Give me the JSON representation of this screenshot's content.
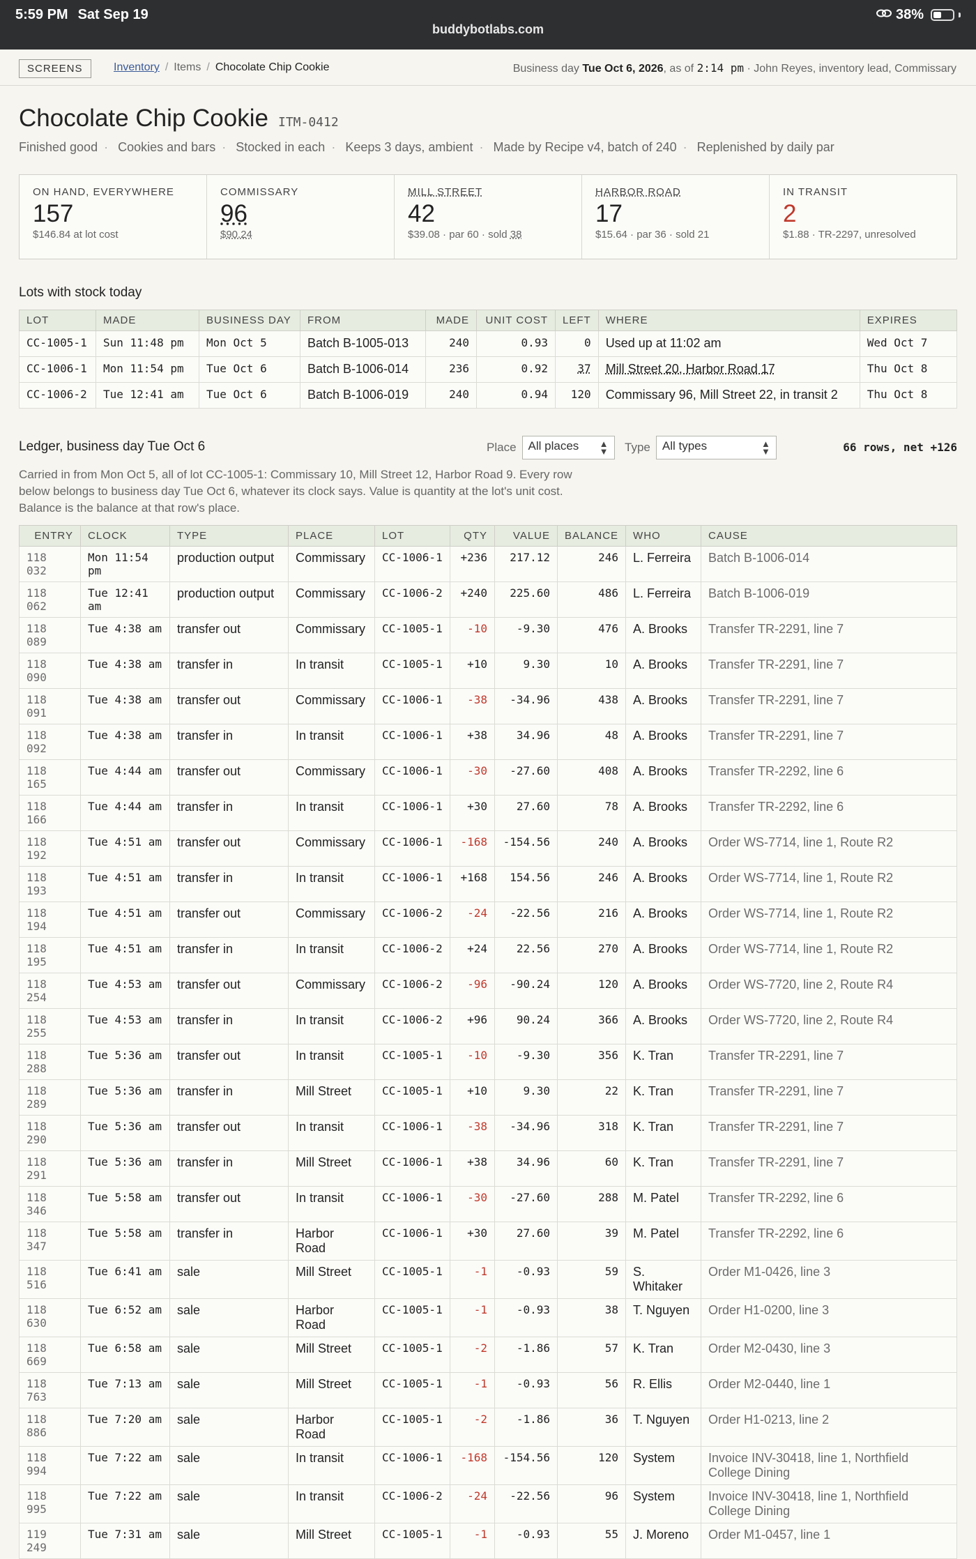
{
  "status_bar": {
    "time": "5:59 PM",
    "date": "Sat Sep 19",
    "url": "buddybotlabs.com",
    "battery": "38%",
    "link_icon": "link-icon"
  },
  "nav": {
    "screens_label": "SCREENS",
    "crumb_inventory": "Inventory",
    "crumb_items": "Items",
    "crumb_current": "Chocolate Chip Cookie",
    "biz_prefix": "Business day ",
    "biz_day": "Tue Oct 6, 2026",
    "biz_asof": ", as of ",
    "biz_time": "2:14 pm",
    "biz_user": " · John Reyes, inventory lead, Commissary"
  },
  "item": {
    "title": "Chocolate Chip Cookie",
    "code": "ITM-0412",
    "meta": [
      "Finished good",
      "Cookies and bars",
      "Stocked in each",
      "Keeps 3 days, ambient",
      "Made by Recipe v4, batch of 240",
      "Replenished by daily par"
    ]
  },
  "cards": [
    {
      "label": "ON HAND, EVERYWHERE",
      "value": "157",
      "sub": "$146.84 at lot cost"
    },
    {
      "label": "COMMISSARY",
      "value": "96",
      "sub": "$90.24"
    },
    {
      "label": "MILL STREET",
      "value": "42",
      "sub": "$39.08 · par 60 · sold ",
      "sub2": "38"
    },
    {
      "label": "HARBOR ROAD",
      "value": "17",
      "sub": "$15.64 · par 36 · sold 21"
    },
    {
      "label": "IN TRANSIT",
      "value": "2",
      "sub": "$1.88 · TR-2297, unresolved"
    }
  ],
  "lots_title": "Lots with stock today",
  "lots_headers": [
    "LOT",
    "MADE",
    "BUSINESS DAY",
    "FROM",
    "MADE",
    "UNIT COST",
    "LEFT",
    "WHERE",
    "EXPIRES"
  ],
  "lots": [
    [
      "CC-1005-1",
      "Sun 11:48 pm",
      "Mon Oct 5",
      "Batch B-1005-013",
      "240",
      "0.93",
      "0",
      "Used up at 11:02 am",
      "Wed Oct 7"
    ],
    [
      "CC-1006-1",
      "Mon 11:54 pm",
      "Tue Oct 6",
      "Batch B-1006-014",
      "236",
      "0.92",
      "37",
      "Mill Street 20, Harbor Road 17",
      "Thu Oct 8"
    ],
    [
      "CC-1006-2",
      "Tue 12:41 am",
      "Tue Oct 6",
      "Batch B-1006-019",
      "240",
      "0.94",
      "120",
      "Commissary 96, Mill Street 22, in transit 2",
      "Thu Oct 8"
    ]
  ],
  "ledger": {
    "title": "Ledger, business day Tue Oct 6",
    "place_label": "Place",
    "place_value": "All places",
    "type_label": "Type",
    "type_value": "All types",
    "count": "66 rows, net +126",
    "carried": "Carried in from Mon Oct 5, all of lot CC-1005-1: Commissary 10, Mill Street 12, Harbor Road 9. Every row below belongs to business day Tue Oct 6, whatever its clock says. Value is quantity at the lot's unit cost. Balance is the balance at that row's place.",
    "headers": [
      "ENTRY",
      "CLOCK",
      "TYPE",
      "PLACE",
      "LOT",
      "QTY",
      "VALUE",
      "BALANCE",
      "WHO",
      "CAUSE"
    ],
    "rows": [
      [
        "118 032",
        "Mon 11:54 pm",
        "production output",
        "Commissary",
        "CC-1006-1",
        "+236",
        "217.12",
        "246",
        "L. Ferreira",
        "Batch B-1006-014"
      ],
      [
        "118 062",
        "Tue 12:41 am",
        "production output",
        "Commissary",
        "CC-1006-2",
        "+240",
        "225.60",
        "486",
        "L. Ferreira",
        "Batch B-1006-019"
      ],
      [
        "118 089",
        "Tue 4:38 am",
        "transfer out",
        "Commissary",
        "CC-1005-1",
        "-10",
        "-9.30",
        "476",
        "A. Brooks",
        "Transfer TR-2291, line 7"
      ],
      [
        "118 090",
        "Tue 4:38 am",
        "transfer in",
        "In transit",
        "CC-1005-1",
        "+10",
        "9.30",
        "10",
        "A. Brooks",
        "Transfer TR-2291, line 7"
      ],
      [
        "118 091",
        "Tue 4:38 am",
        "transfer out",
        "Commissary",
        "CC-1006-1",
        "-38",
        "-34.96",
        "438",
        "A. Brooks",
        "Transfer TR-2291, line 7"
      ],
      [
        "118 092",
        "Tue 4:38 am",
        "transfer in",
        "In transit",
        "CC-1006-1",
        "+38",
        "34.96",
        "48",
        "A. Brooks",
        "Transfer TR-2291, line 7"
      ],
      [
        "118 165",
        "Tue 4:44 am",
        "transfer out",
        "Commissary",
        "CC-1006-1",
        "-30",
        "-27.60",
        "408",
        "A. Brooks",
        "Transfer TR-2292, line 6"
      ],
      [
        "118 166",
        "Tue 4:44 am",
        "transfer in",
        "In transit",
        "CC-1006-1",
        "+30",
        "27.60",
        "78",
        "A. Brooks",
        "Transfer TR-2292, line 6"
      ],
      [
        "118 192",
        "Tue 4:51 am",
        "transfer out",
        "Commissary",
        "CC-1006-1",
        "-168",
        "-154.56",
        "240",
        "A. Brooks",
        "Order WS-7714, line 1, Route R2"
      ],
      [
        "118 193",
        "Tue 4:51 am",
        "transfer in",
        "In transit",
        "CC-1006-1",
        "+168",
        "154.56",
        "246",
        "A. Brooks",
        "Order WS-7714, line 1, Route R2"
      ],
      [
        "118 194",
        "Tue 4:51 am",
        "transfer out",
        "Commissary",
        "CC-1006-2",
        "-24",
        "-22.56",
        "216",
        "A. Brooks",
        "Order WS-7714, line 1, Route R2"
      ],
      [
        "118 195",
        "Tue 4:51 am",
        "transfer in",
        "In transit",
        "CC-1006-2",
        "+24",
        "22.56",
        "270",
        "A. Brooks",
        "Order WS-7714, line 1, Route R2"
      ],
      [
        "118 254",
        "Tue 4:53 am",
        "transfer out",
        "Commissary",
        "CC-1006-2",
        "-96",
        "-90.24",
        "120",
        "A. Brooks",
        "Order WS-7720, line 2, Route R4"
      ],
      [
        "118 255",
        "Tue 4:53 am",
        "transfer in",
        "In transit",
        "CC-1006-2",
        "+96",
        "90.24",
        "366",
        "A. Brooks",
        "Order WS-7720, line 2, Route R4"
      ],
      [
        "118 288",
        "Tue 5:36 am",
        "transfer out",
        "In transit",
        "CC-1005-1",
        "-10",
        "-9.30",
        "356",
        "K. Tran",
        "Transfer TR-2291, line 7"
      ],
      [
        "118 289",
        "Tue 5:36 am",
        "transfer in",
        "Mill Street",
        "CC-1005-1",
        "+10",
        "9.30",
        "22",
        "K. Tran",
        "Transfer TR-2291, line 7"
      ],
      [
        "118 290",
        "Tue 5:36 am",
        "transfer out",
        "In transit",
        "CC-1006-1",
        "-38",
        "-34.96",
        "318",
        "K. Tran",
        "Transfer TR-2291, line 7"
      ],
      [
        "118 291",
        "Tue 5:36 am",
        "transfer in",
        "Mill Street",
        "CC-1006-1",
        "+38",
        "34.96",
        "60",
        "K. Tran",
        "Transfer TR-2291, line 7"
      ],
      [
        "118 346",
        "Tue 5:58 am",
        "transfer out",
        "In transit",
        "CC-1006-1",
        "-30",
        "-27.60",
        "288",
        "M. Patel",
        "Transfer TR-2292, line 6"
      ],
      [
        "118 347",
        "Tue 5:58 am",
        "transfer in",
        "Harbor Road",
        "CC-1006-1",
        "+30",
        "27.60",
        "39",
        "M. Patel",
        "Transfer TR-2292, line 6"
      ],
      [
        "118 516",
        "Tue 6:41 am",
        "sale",
        "Mill Street",
        "CC-1005-1",
        "-1",
        "-0.93",
        "59",
        "S. Whitaker",
        "Order M1-0426, line 3"
      ],
      [
        "118 630",
        "Tue 6:52 am",
        "sale",
        "Harbor Road",
        "CC-1005-1",
        "-1",
        "-0.93",
        "38",
        "T. Nguyen",
        "Order H1-0200, line 3"
      ],
      [
        "118 669",
        "Tue 6:58 am",
        "sale",
        "Mill Street",
        "CC-1005-1",
        "-2",
        "-1.86",
        "57",
        "K. Tran",
        "Order M2-0430, line 3"
      ],
      [
        "118 763",
        "Tue 7:13 am",
        "sale",
        "Mill Street",
        "CC-1005-1",
        "-1",
        "-0.93",
        "56",
        "R. Ellis",
        "Order M2-0440, line 1"
      ],
      [
        "118 886",
        "Tue 7:20 am",
        "sale",
        "Harbor Road",
        "CC-1005-1",
        "-2",
        "-1.86",
        "36",
        "T. Nguyen",
        "Order H1-0213, line 2"
      ],
      [
        "118 994",
        "Tue 7:22 am",
        "sale",
        "In transit",
        "CC-1006-1",
        "-168",
        "-154.56",
        "120",
        "System",
        "Invoice INV-30418, line 1, Northfield College Dining"
      ],
      [
        "118 995",
        "Tue 7:22 am",
        "sale",
        "In transit",
        "CC-1006-2",
        "-24",
        "-22.56",
        "96",
        "System",
        "Invoice INV-30418, line 1, Northfield College Dining"
      ],
      [
        "119 249",
        "Tue 7:31 am",
        "sale",
        "Mill Street",
        "CC-1005-1",
        "-1",
        "-0.93",
        "55",
        "J. Moreno",
        "Order M1-0457, line 1"
      ]
    ]
  },
  "colors": {
    "negative": "#c0392b",
    "header_bg": "#e6ece0",
    "page_bg": "#f6f5f0"
  }
}
